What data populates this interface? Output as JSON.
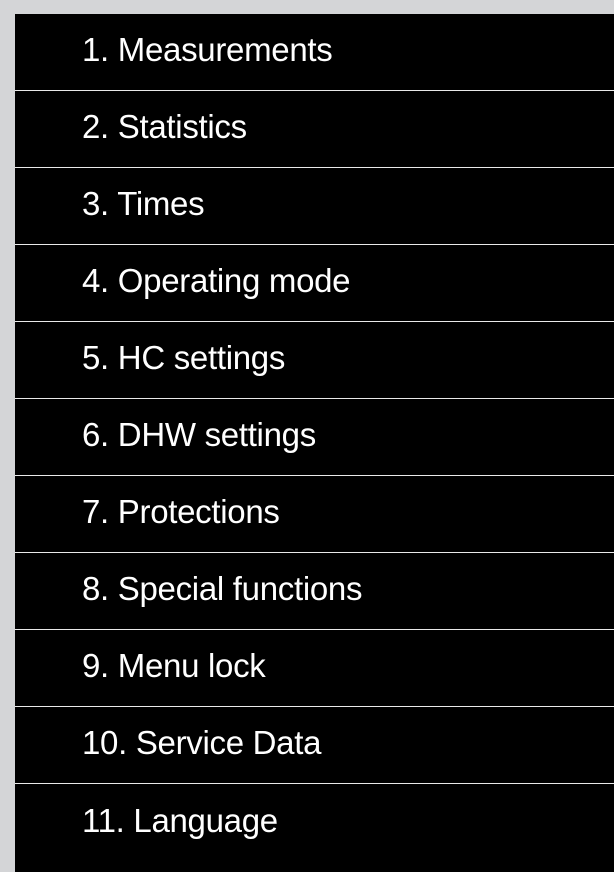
{
  "menu": {
    "items": [
      {
        "label": "1. Measurements"
      },
      {
        "label": "2. Statistics"
      },
      {
        "label": "3. Times"
      },
      {
        "label": "4. Operating mode"
      },
      {
        "label": "5. HC settings"
      },
      {
        "label": "6. DHW settings"
      },
      {
        "label": "7. Protections"
      },
      {
        "label": "8. Special functions"
      },
      {
        "label": "9. Menu lock"
      },
      {
        "label": "10. Service Data"
      },
      {
        "label": "11. Language"
      }
    ]
  },
  "colors": {
    "background": "#d4d5d7",
    "menu_background": "#000000",
    "divider": "#e9e9e9",
    "text": "#ffffff"
  }
}
